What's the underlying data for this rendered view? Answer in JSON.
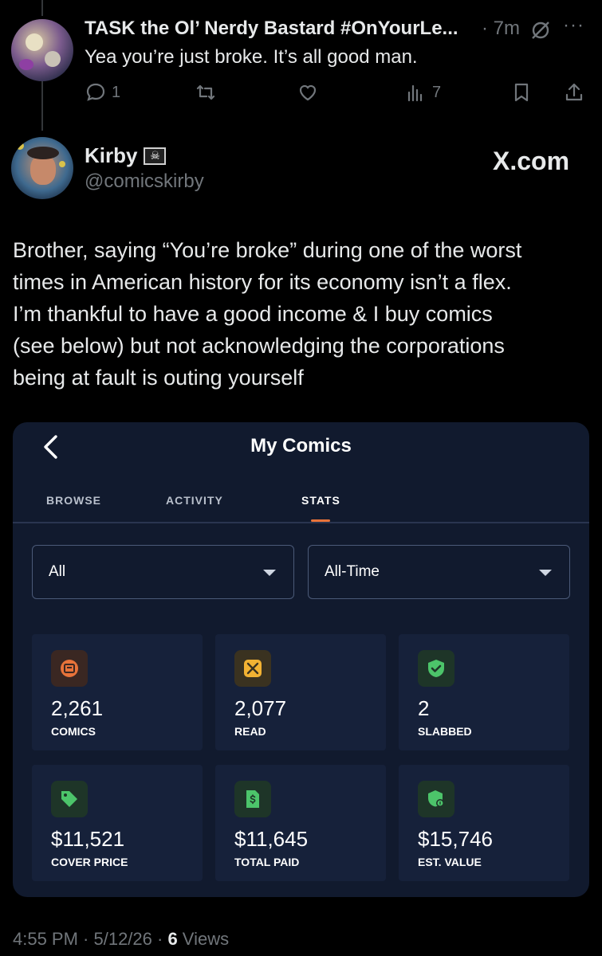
{
  "reply": {
    "name": "TASK the Ol’ Nerdy Bastard #OnYourLe...",
    "time": "· 7m",
    "more": "···",
    "text": "Yea you’re just broke. It’s all good man.",
    "replies": "1",
    "views": "7"
  },
  "post": {
    "name": "Kirby",
    "flag_glyph": "☠",
    "handle": "@comicskirby",
    "source": "X.com",
    "lines": [
      "Brother, saying “You’re broke” during one of the worst",
      "times in American history for its economy isn’t a flex.",
      "I’m thankful to have a good income & I buy comics",
      "(see below) but not acknowledging the corporations",
      "being at fault is outing yourself"
    ]
  },
  "app": {
    "title": "My Comics",
    "tabs": [
      "BROWSE",
      "ACTIVITY",
      "STATS"
    ],
    "active_tab": "STATS",
    "filter_1": "All",
    "filter_2": "All-Time",
    "stats": [
      {
        "value": "2,261",
        "label": "COMICS",
        "icon": "comic-stack-icon",
        "color": "#e8733a"
      },
      {
        "value": "2,077",
        "label": "READ",
        "icon": "read-book-icon",
        "color": "#f2b233"
      },
      {
        "value": "2",
        "label": "SLABBED",
        "icon": "shield-check-icon",
        "color": "#4cc46a"
      },
      {
        "value": "$11,521",
        "label": "COVER PRICE",
        "icon": "price-tag-icon",
        "color": "#4cc46a"
      },
      {
        "value": "$11,645",
        "label": "TOTAL PAID",
        "icon": "dollar-doc-icon",
        "color": "#4cc46a"
      },
      {
        "value": "$15,746",
        "label": "EST. VALUE",
        "icon": "value-shield-icon",
        "color": "#4cc46a"
      }
    ]
  },
  "footer": {
    "time": "4:55 PM · 5/12/26 · ",
    "views_count": "6",
    "views_label": " Views"
  }
}
